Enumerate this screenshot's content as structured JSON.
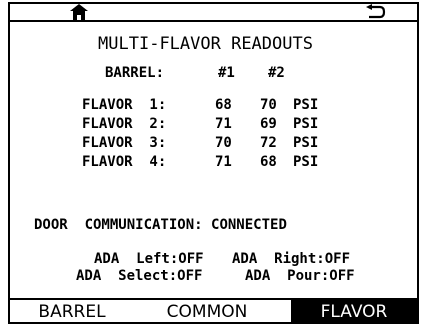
{
  "title": "MULTI-FLAVOR READOUTS",
  "header": {
    "label": "BARREL:",
    "col1": "#1",
    "col2": "#2"
  },
  "rows": [
    {
      "label": "FLAVOR  1:",
      "v1": "68",
      "v2": "70",
      "unit": "PSI"
    },
    {
      "label": "FLAVOR  2:",
      "v1": "71",
      "v2": "69",
      "unit": "PSI"
    },
    {
      "label": "FLAVOR  3:",
      "v1": "70",
      "v2": "72",
      "unit": "PSI"
    },
    {
      "label": "FLAVOR  4:",
      "v1": "71",
      "v2": "68",
      "unit": "PSI"
    }
  ],
  "door": {
    "label": "DOOR  COMMUNICATION:",
    "status": "CONNECTED"
  },
  "ada": {
    "left_label": "ADA  Left:",
    "left_value": "OFF",
    "right_label": "ADA  Right:",
    "right_value": "OFF",
    "select_label": "ADA  Select:",
    "select_value": "OFF",
    "pour_label": "ADA  Pour:",
    "pour_value": "OFF"
  },
  "tabs": {
    "barrel": "BARREL",
    "common": "COMMON",
    "flavor": "FLAVOR",
    "active": "FLAVOR"
  },
  "icons": {
    "home": "home-icon",
    "back": "back-icon"
  }
}
